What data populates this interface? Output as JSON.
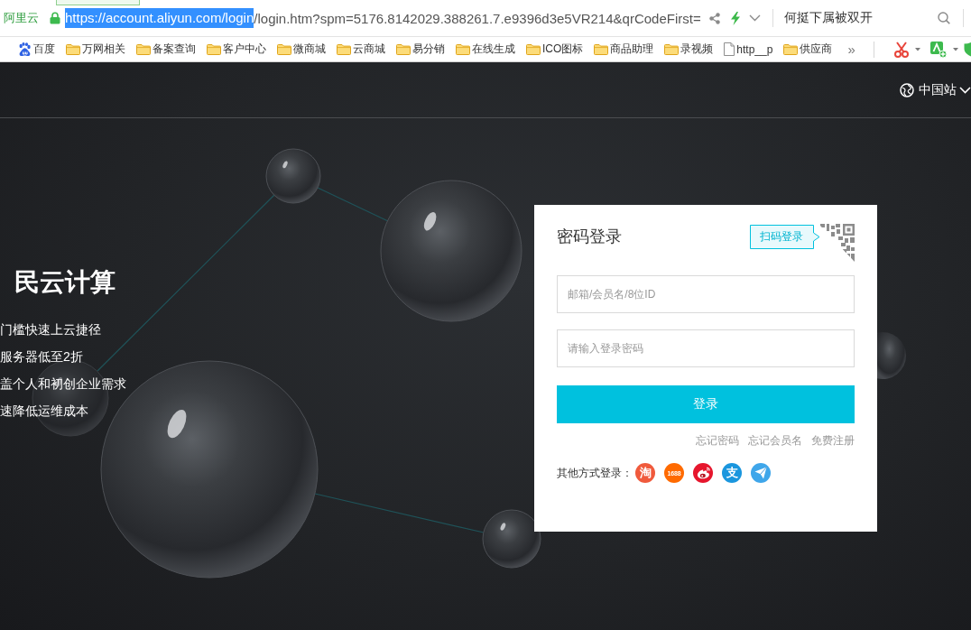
{
  "browser": {
    "site_label": "阿里云",
    "address": {
      "secure": true,
      "selected": "https://account.aliyun.com/login",
      "rest": "/login.htm?spm=5176.8142029.388261.7.e9396d3e5VR214&qrCodeFirst="
    },
    "search": {
      "value": "何挺下属被双开"
    }
  },
  "bookmarks": {
    "items": [
      {
        "kind": "paw",
        "label": "百度"
      },
      {
        "kind": "folder",
        "label": "万网相关"
      },
      {
        "kind": "folder",
        "label": "备案查询"
      },
      {
        "kind": "folder",
        "label": "客户中心"
      },
      {
        "kind": "folder",
        "label": "微商城"
      },
      {
        "kind": "folder",
        "label": "云商城"
      },
      {
        "kind": "folder",
        "label": "易分销"
      },
      {
        "kind": "folder",
        "label": "在线生成"
      },
      {
        "kind": "folder",
        "label": "ICO图标"
      },
      {
        "kind": "folder",
        "label": "商品助理"
      },
      {
        "kind": "folder",
        "label": "录视频"
      },
      {
        "kind": "page",
        "label": "http__p"
      },
      {
        "kind": "folder",
        "label": "供应商"
      }
    ],
    "more": "»"
  },
  "header": {
    "region": "中国站"
  },
  "hero": {
    "title": "民云计算",
    "points": [
      "门槛快速上云捷径",
      "服务器低至2折",
      "盖个人和初创企业需求",
      "速降低运维成本"
    ]
  },
  "login": {
    "title": "密码登录",
    "qr_tab": "扫码登录",
    "username": {
      "placeholder": "邮箱/会员名/8位ID"
    },
    "password": {
      "placeholder": "请输入登录密码"
    },
    "submit": "登录",
    "links": [
      "忘记密码",
      "忘记会员名",
      "免费注册"
    ],
    "others_label": "其他方式登录：",
    "others": [
      {
        "kind": "glyph",
        "label": "淘",
        "color": "#f05a3c"
      },
      {
        "kind": "wordmark",
        "label": "1688",
        "color": "#ff6a00"
      },
      {
        "kind": "eye",
        "color": "#e6162d"
      },
      {
        "kind": "glyph",
        "label": "支",
        "color": "#1a96de"
      },
      {
        "kind": "plane",
        "color": "#3fa6ea"
      }
    ]
  }
}
